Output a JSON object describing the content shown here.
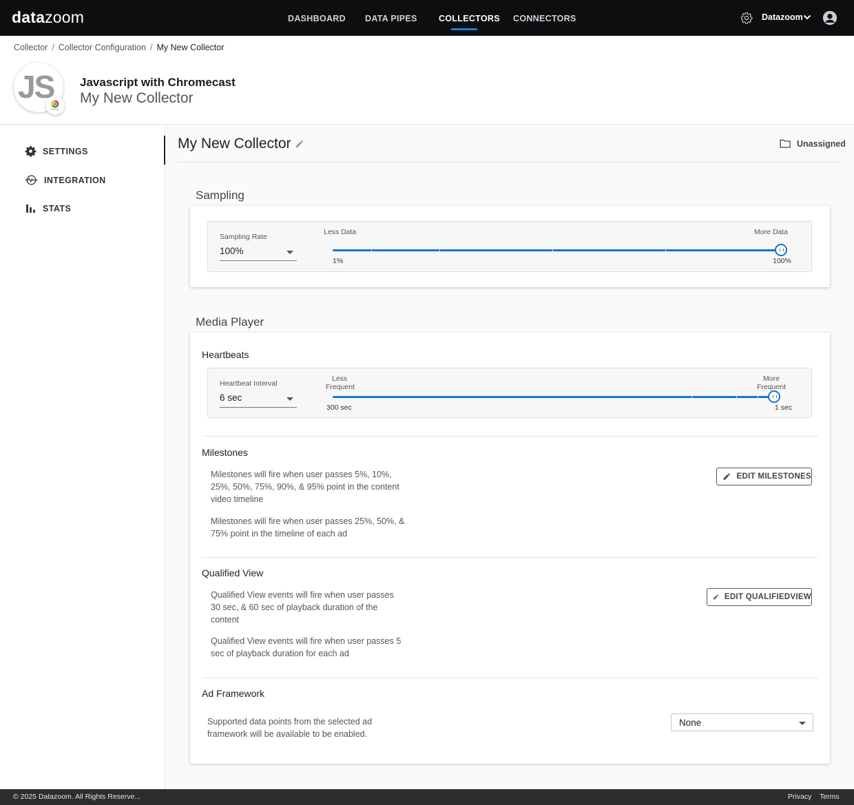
{
  "brand": {
    "logo_bold": "data",
    "logo_thin": "zoom"
  },
  "nav": {
    "items": [
      {
        "label": "DASHBOARD"
      },
      {
        "label": "DATA PIPES"
      },
      {
        "label": "COLLECTORS",
        "active": true
      },
      {
        "label": "CONNECTORS"
      }
    ],
    "org_label": "Datazoom",
    "icons": [
      "gear-icon",
      "chevron-down-icon",
      "account-icon"
    ]
  },
  "breadcrumb": [
    "Collector",
    "Collector Configuration",
    "My New Collector"
  ],
  "header": {
    "badge_text": "JS",
    "title": "Javascript with Chromecast",
    "subtitle": "My New Collector"
  },
  "sidebar": {
    "items": [
      {
        "label": "SETTINGS",
        "icon": "gear-icon",
        "active": true
      },
      {
        "label": "INTEGRATION",
        "icon": "pulse-icon"
      },
      {
        "label": "STATS",
        "icon": "bar-chart-icon"
      }
    ]
  },
  "main": {
    "title": "My New Collector",
    "assignment": "Unassigned",
    "sampling": {
      "heading": "Sampling",
      "field_label": "Sampling Rate",
      "field_value": "100%",
      "slider_left_label": "Less Data",
      "slider_right_label": "More Data",
      "slider_min": "1%",
      "slider_max": "100%",
      "slider_position": 1.0
    },
    "media_player": {
      "heading": "Media Player",
      "heartbeats": {
        "heading": "Heartbeats",
        "field_label": "Heartbeat Interval",
        "field_value": "6 sec",
        "slider_left_label_1": "Less",
        "slider_left_label_2": "Frequent",
        "slider_right_label_1": "More",
        "slider_right_label_2": "Frequent",
        "slider_min": "300 sec",
        "slider_max": "1 sec",
        "slider_position": 0.99
      },
      "milestones": {
        "heading": "Milestones",
        "text_1": "Milestones will fire when user passes 5%, 10%, 25%, 50%, 75%, 90%, & 95% point in the content video timeline",
        "text_2": "Milestones will fire when user passes 25%, 50%, & 75% point in the timeline of each ad",
        "button": "EDIT MILESTONES"
      },
      "qualified_view": {
        "heading": "Qualified View",
        "text_1": "Qualified View events will fire when user passes 30 sec, & 60 sec of playback duration of the content",
        "text_2": "Qualified View events will fire when user passes 5 sec of playback duration for each ad",
        "button": "EDIT QUALIFIEDVIEW"
      },
      "ad_framework": {
        "heading": "Ad Framework",
        "text": "Supported data points from the selected ad framework will be available to be enabled.",
        "select_value": "None"
      }
    }
  },
  "footer": {
    "copyright": "© 2025 Datazoom. All Rights Reserve...",
    "links": [
      "Privacy",
      "Terms"
    ]
  },
  "colors": {
    "accent": "#1a73c8",
    "topbar": "#0d0e10",
    "footer": "#2d2d2f"
  }
}
